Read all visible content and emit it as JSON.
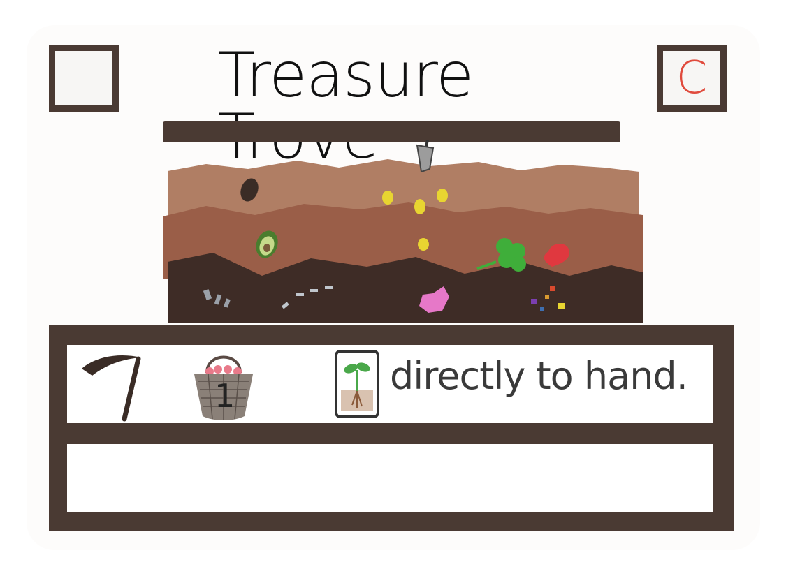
{
  "card": {
    "title": "Treasure Trove",
    "cost_letter": "C",
    "basket_number": "1",
    "effect_text": "directly to hand."
  },
  "colors": {
    "frame": "#4a3a33",
    "cost_letter": "#e04a3c",
    "soil_top": "#b07e64",
    "soil_mid": "#9a5e48",
    "soil_bottom": "#3e2c26"
  },
  "icons": [
    "scythe-icon",
    "basket-icon",
    "seedling-card-icon",
    "shovel-icon",
    "coin-icon",
    "clover-icon",
    "heart-icon",
    "avocado-icon",
    "seed-icon",
    "gem-icon",
    "flower-icon"
  ]
}
